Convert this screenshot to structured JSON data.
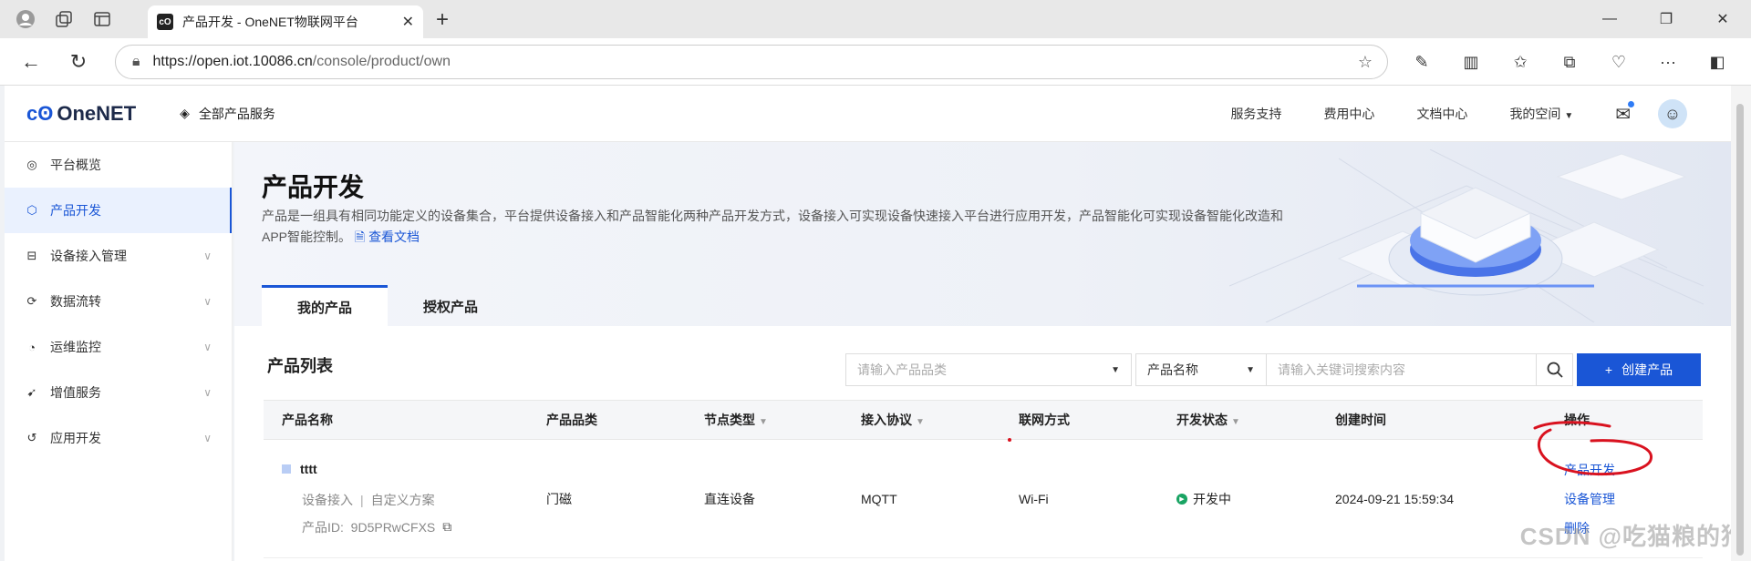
{
  "browser": {
    "tab_title": "产品开发 - OneNET物联网平台",
    "url_host": "https://open.iot.10086.cn",
    "url_path": "/console/product/own"
  },
  "header": {
    "logo": "OneNET",
    "all_products": "全部产品服务",
    "nav": [
      "服务支持",
      "费用中心",
      "文档中心",
      "我的空间"
    ]
  },
  "sidebar": {
    "items": [
      {
        "label": "平台概览",
        "icon": "overview-icon"
      },
      {
        "label": "产品开发",
        "icon": "cube-icon"
      },
      {
        "label": "设备接入管理",
        "icon": "device-icon"
      },
      {
        "label": "数据流转",
        "icon": "flow-icon"
      },
      {
        "label": "运维监控",
        "icon": "monitor-icon"
      },
      {
        "label": "增值服务",
        "icon": "service-icon"
      },
      {
        "label": "应用开发",
        "icon": "app-icon"
      }
    ]
  },
  "page": {
    "title": "产品开发",
    "description": "产品是一组具有相同功能定义的设备集合，平台提供设备接入和产品智能化两种产品开发方式，设备接入可实现设备快速接入平台进行应用开发，产品智能化可实现设备智能化改造和APP智能控制。",
    "doc_link": "查看文档",
    "tabs": [
      "我的产品",
      "授权产品"
    ]
  },
  "list": {
    "title": "产品列表",
    "category_placeholder": "请输入产品品类",
    "field_select": "产品名称",
    "search_placeholder": "请输入关键词搜索内容",
    "create_label": "创建产品",
    "columns": [
      "产品名称",
      "产品品类",
      "节点类型",
      "接入协议",
      "联网方式",
      "开发状态",
      "创建时间",
      "操作"
    ],
    "rows": [
      {
        "name": "tttt",
        "access": "设备接入",
        "scheme": "自定义方案",
        "id_label": "产品ID:",
        "id": "9D5PRwCFXS",
        "category": "门磁",
        "node_type": "直连设备",
        "protocol": "MQTT",
        "network": "Wi-Fi",
        "status": "开发中",
        "created": "2024-09-21 15:59:34",
        "ops": [
          "产品开发",
          "设备管理",
          "删除"
        ]
      }
    ]
  },
  "watermark": "CSDN @吃猫粮的狗",
  "colors": {
    "accent": "#1a56d6",
    "status_ok": "#19a463",
    "annotation": "#d9121f"
  }
}
